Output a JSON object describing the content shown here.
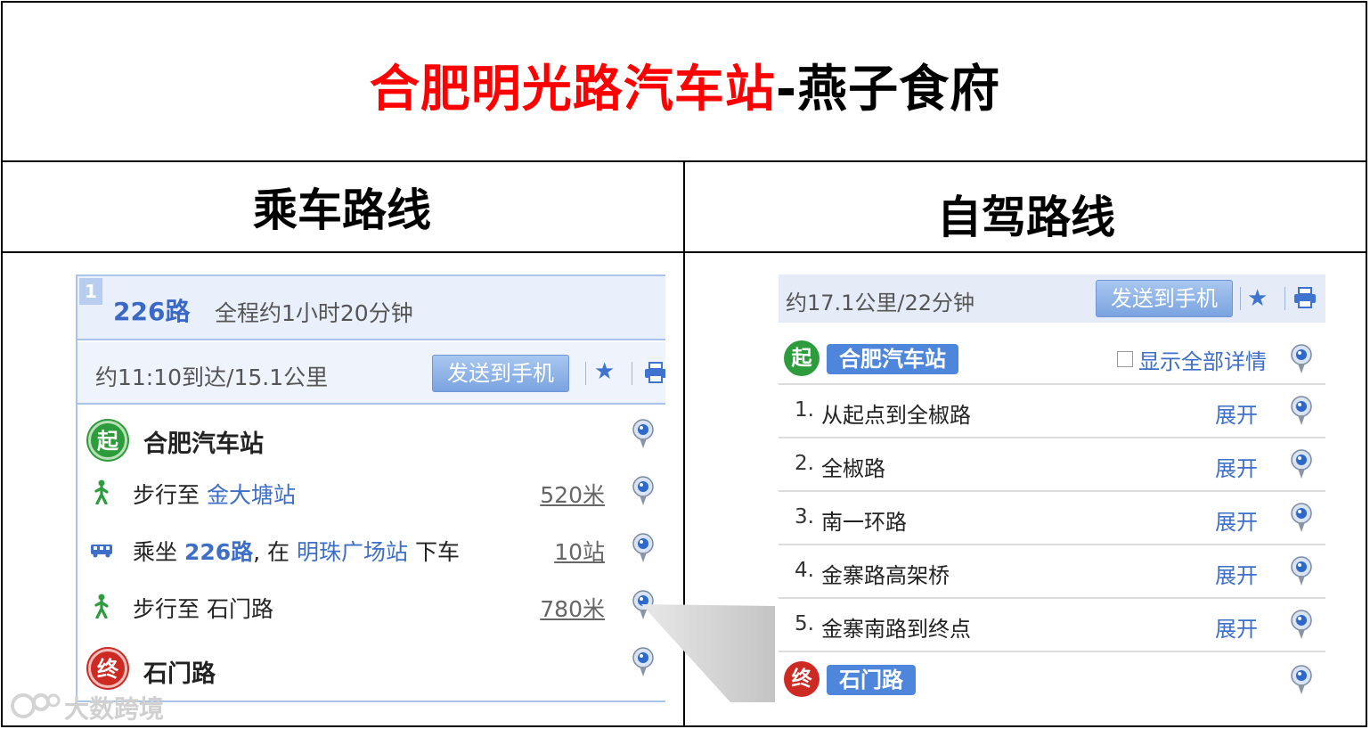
{
  "title": {
    "red_part": "合肥明光路汽车站",
    "black_part": "-燕子食府"
  },
  "columns": {
    "transit": "乘车路线",
    "drive": "自驾路线"
  },
  "transit": {
    "index": "1",
    "route_name": "226路",
    "total_time": "全程约1小时20分钟",
    "arrival": "约11:10到达/15.1公里",
    "send_button": "发送到手机",
    "start": {
      "badge": "起",
      "name": "合肥汽车站"
    },
    "steps": [
      {
        "icon": "walk-icon",
        "prefix": "步行至 ",
        "link": "金大塘站",
        "suffix": "",
        "distance": "520米"
      },
      {
        "icon": "bus-icon",
        "prefix": "乘坐 ",
        "link": "226路",
        "mid": ", 在 ",
        "link2": "明珠广场站",
        "suffix": " 下车",
        "distance": "10站"
      },
      {
        "icon": "walk-icon",
        "prefix": "步行至 石门路",
        "link": "",
        "suffix": "",
        "distance": "780米"
      }
    ],
    "end": {
      "badge": "终",
      "name": "石门路"
    }
  },
  "drive": {
    "summary": "约17.1公里/22分钟",
    "send_button": "发送到手机",
    "start": {
      "badge": "起",
      "name": "合肥汽车站"
    },
    "show_all": "显示全部详情",
    "steps": [
      {
        "num": "1.",
        "text": "从起点到全椒路",
        "action": "展开"
      },
      {
        "num": "2.",
        "text": "全椒路",
        "action": "展开"
      },
      {
        "num": "3.",
        "text": "南一环路",
        "action": "展开"
      },
      {
        "num": "4.",
        "text": "金寨路高架桥",
        "action": "展开"
      },
      {
        "num": "5.",
        "text": "金寨南路到终点",
        "action": "展开"
      }
    ],
    "end": {
      "badge": "终",
      "name": "石门路"
    }
  },
  "watermark": "大数跨境",
  "colors": {
    "title_red": "#ff0000",
    "link_blue": "#3e6fc8",
    "start_green": "#2d9c3c",
    "end_red": "#cc2a23"
  }
}
